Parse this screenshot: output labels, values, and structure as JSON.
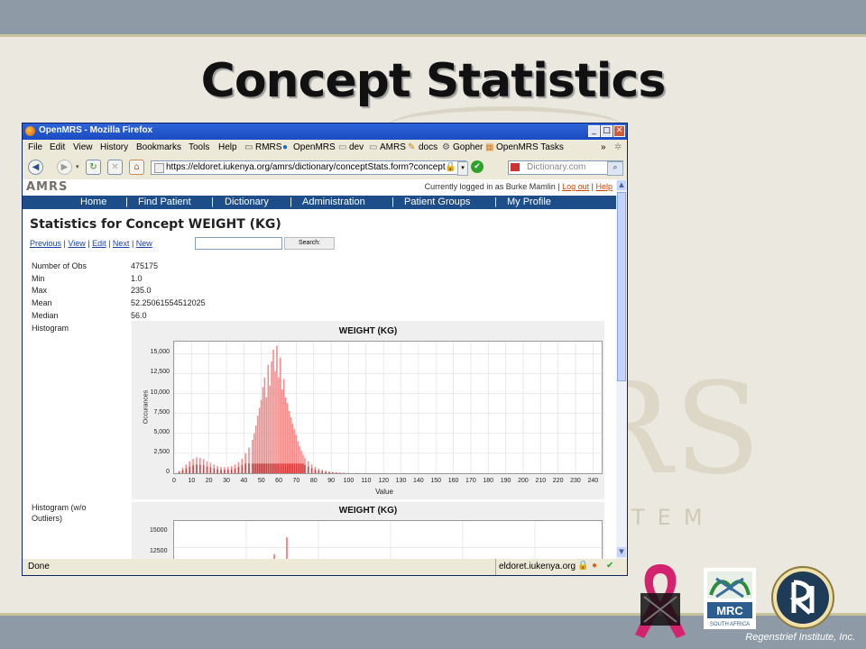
{
  "slide": {
    "title": "Concept Statistics",
    "credit": "Regenstrief Institute, Inc.",
    "watermark_letters": "RS",
    "watermark_word": "TEM"
  },
  "browser": {
    "window_title": "OpenMRS - Mozilla Firefox",
    "menu": [
      "File",
      "Edit",
      "View",
      "History",
      "Bookmarks",
      "Tools",
      "Help"
    ],
    "bookmarks": [
      "RMRS",
      "OpenMRS",
      "dev",
      "AMRS",
      "docs",
      "Gopher",
      "OpenMRS Tasks"
    ],
    "url": "https://eldoret.iukenya.org/amrs/dictionary/conceptStats.form?concept",
    "search_placeholder": "Dictionary.com",
    "status_left": "Done",
    "status_domain": "eldoret.iukenya.org"
  },
  "page": {
    "logo": "AMRS",
    "user_text": "Currently logged in as Burke Mamlin",
    "logout": "Log out",
    "help": "Help",
    "nav": [
      "Home",
      "Find Patient",
      "Dictionary",
      "Administration",
      "Patient Groups",
      "My Profile"
    ],
    "title": "Statistics for Concept WEIGHT (KG)",
    "links": [
      "Previous",
      "View",
      "Edit",
      "Next",
      "New"
    ],
    "search_button": "Search:",
    "stats": [
      {
        "label": "Number of Obs",
        "value": "475175"
      },
      {
        "label": "Min",
        "value": "1.0"
      },
      {
        "label": "Max",
        "value": "235.0"
      },
      {
        "label": "Mean",
        "value": "52.25061554512025"
      },
      {
        "label": "Median",
        "value": "56.0"
      }
    ],
    "histogram_label": "Histogram",
    "histogram2_label": "Histogram (w/o\nOutliers)"
  },
  "chart_data": [
    {
      "type": "bar",
      "title": "WEIGHT (KG)",
      "xlabel": "Value",
      "ylabel": "Occurances",
      "xlim": [
        0,
        245
      ],
      "ylim": [
        0,
        16500
      ],
      "xticks": [
        0,
        10,
        20,
        30,
        40,
        50,
        60,
        70,
        80,
        90,
        100,
        110,
        120,
        130,
        140,
        150,
        160,
        170,
        180,
        190,
        200,
        210,
        220,
        230,
        240
      ],
      "yticks": [
        0,
        2500,
        5000,
        7500,
        10000,
        12500,
        15000
      ],
      "grid": true,
      "colors": {
        "bars": "#f58a8a",
        "dense": "#d43c3c"
      },
      "series": [
        {
          "x": [
            3,
            5,
            7,
            9,
            11,
            13,
            15,
            17,
            19,
            21,
            23,
            25,
            27,
            29,
            31,
            33,
            35,
            37,
            39,
            41,
            43,
            45,
            46,
            47,
            48,
            49,
            50,
            51,
            52,
            53,
            54,
            55,
            56,
            57,
            58,
            59,
            60,
            61,
            62,
            63,
            64,
            65,
            66,
            67,
            68,
            69,
            70,
            71,
            72,
            73,
            74,
            75,
            77,
            79,
            81,
            83,
            85,
            87,
            89,
            91,
            93,
            95,
            97,
            100,
            105,
            110
          ],
          "values": [
            300,
            700,
            1100,
            1500,
            1800,
            2000,
            1900,
            1800,
            1500,
            1300,
            1100,
            900,
            800,
            750,
            800,
            900,
            1100,
            1400,
            1800,
            2500,
            3200,
            4200,
            5000,
            6000,
            7200,
            8200,
            9200,
            10800,
            12000,
            9500,
            13600,
            11000,
            14000,
            15500,
            12800,
            16000,
            12000,
            14500,
            10500,
            11800,
            9500,
            8800,
            7800,
            7000,
            6200,
            5500,
            4800,
            4000,
            3400,
            2800,
            2300,
            1900,
            1500,
            1100,
            800,
            600,
            450,
            320,
            220,
            160,
            110,
            80,
            60,
            40,
            25,
            15
          ]
        }
      ]
    },
    {
      "type": "bar",
      "title": "WEIGHT (KG)",
      "ylabel": "",
      "yticks": [
        12500,
        15000
      ],
      "grid": true,
      "colors": {
        "bars": "#f58a8a",
        "dense": "#d43c3c"
      },
      "series": [
        {
          "x": [
            56,
            58,
            60
          ],
          "values": [
            14500,
            13800,
            15800
          ]
        }
      ]
    }
  ]
}
